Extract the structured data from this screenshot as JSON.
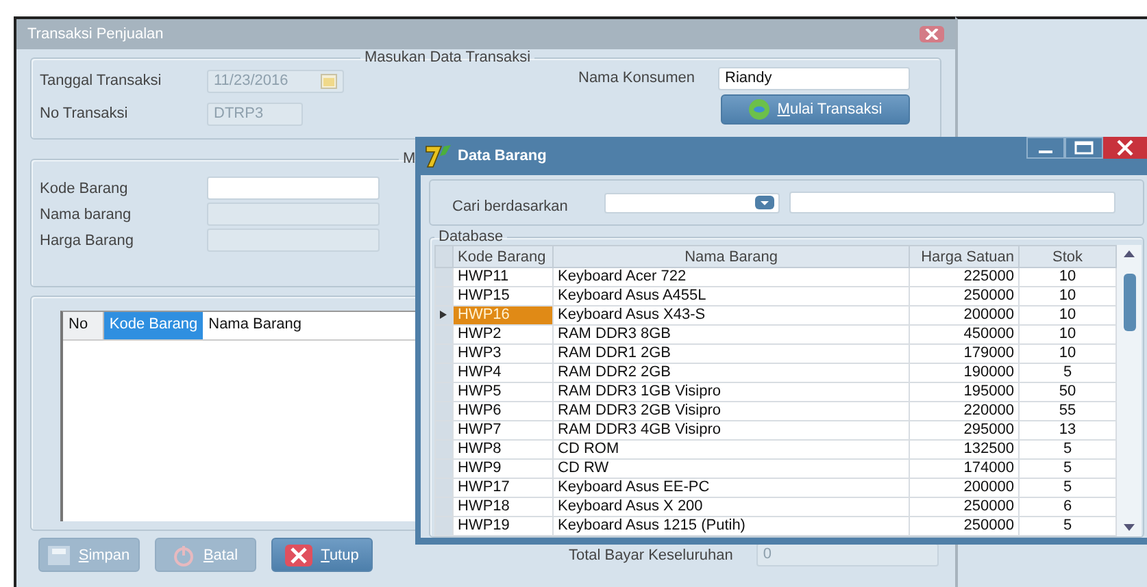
{
  "main_window": {
    "title": "Transaksi Penjualan",
    "transaction_group": {
      "legend": "Masukan Data Transaksi",
      "date_label": "Tanggal Transaksi",
      "date_value": "11/23/2016",
      "number_label": "No Transaksi",
      "number_value": "DTRP3",
      "customer_label": "Nama Konsumen",
      "customer_value": "Riandy",
      "start_button": "Mulai Transaksi"
    },
    "item_group": {
      "legend": "M",
      "fields": [
        {
          "label": "Kode Barang",
          "disabled": false
        },
        {
          "label": "Nama barang",
          "disabled": true
        },
        {
          "label": "Harga Barang",
          "disabled": true
        }
      ]
    },
    "cart_table": {
      "columns": [
        {
          "label": "No",
          "selected": false
        },
        {
          "label": "Kode Barang",
          "selected": true
        },
        {
          "label": "Nama Barang",
          "selected": false
        }
      ]
    },
    "buttons": [
      {
        "kind": "save",
        "label": "Simpan",
        "disabled": true
      },
      {
        "kind": "cancel",
        "label": "Batal",
        "disabled": true
      },
      {
        "kind": "close",
        "label": "Tutup",
        "disabled": false
      }
    ],
    "total": {
      "label": "Total Bayar Keseluruhan",
      "value": "0"
    }
  },
  "dialog": {
    "title": "Data Barang",
    "search_label": "Cari berdasarkan",
    "group_legend": "Database",
    "columns": [
      "Kode Barang",
      "Nama Barang",
      "Harga Satuan",
      "Stok"
    ],
    "rows": [
      {
        "code": "HWP11",
        "name": "Keyboard Acer 722",
        "price": "225000",
        "stock": "10",
        "selected": false
      },
      {
        "code": "HWP15",
        "name": "Keyboard Asus A455L",
        "price": "250000",
        "stock": "10",
        "selected": false
      },
      {
        "code": "HWP16",
        "name": "Keyboard Asus X43-S",
        "price": "200000",
        "stock": "10",
        "selected": true
      },
      {
        "code": "HWP2",
        "name": "RAM DDR3 8GB",
        "price": "450000",
        "stock": "10",
        "selected": false
      },
      {
        "code": "HWP3",
        "name": "RAM DDR1 2GB",
        "price": "179000",
        "stock": "10",
        "selected": false
      },
      {
        "code": "HWP4",
        "name": "RAM DDR2 2GB",
        "price": "190000",
        "stock": "5",
        "selected": false
      },
      {
        "code": "HWP5",
        "name": "RAM DDR3 1GB Visipro",
        "price": "195000",
        "stock": "50",
        "selected": false
      },
      {
        "code": "HWP6",
        "name": "RAM DDR3 2GB Visipro",
        "price": "220000",
        "stock": "55",
        "selected": false
      },
      {
        "code": "HWP7",
        "name": "RAM DDR3 4GB Visipro",
        "price": "295000",
        "stock": "13",
        "selected": false
      },
      {
        "code": "HWP8",
        "name": "CD ROM",
        "price": "132500",
        "stock": "5",
        "selected": false
      },
      {
        "code": "HWP9",
        "name": "CD RW",
        "price": "174000",
        "stock": "5",
        "selected": false
      },
      {
        "code": "HWP17",
        "name": "Keyboard Asus EE-PC",
        "price": "200000",
        "stock": "5",
        "selected": false
      },
      {
        "code": "HWP18",
        "name": "Keyboard Asus X 200",
        "price": "250000",
        "stock": "6",
        "selected": false
      },
      {
        "code": "HWP19",
        "name": "Keyboard Asus 1215 (Putih)",
        "price": "250000",
        "stock": "5",
        "selected": false
      }
    ]
  }
}
